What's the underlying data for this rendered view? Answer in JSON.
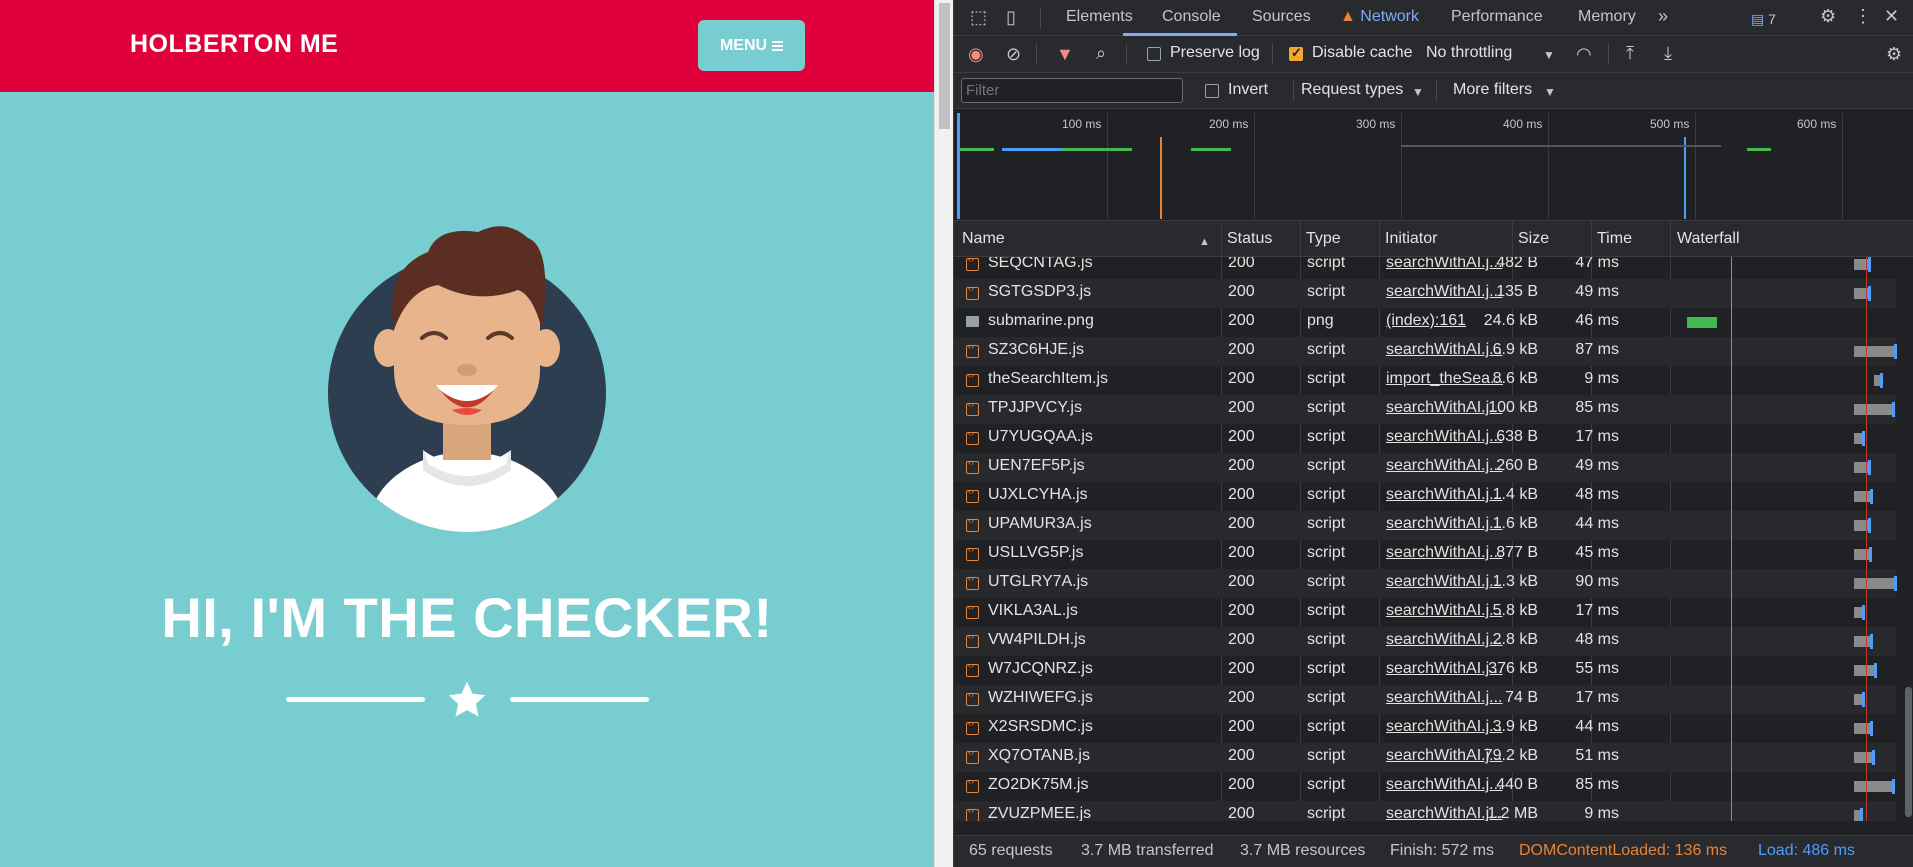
{
  "page": {
    "brand": "HOLBERTON ME",
    "menu_label": "MENU",
    "hero_title": "HI, I'M THE CHECKER!"
  },
  "devtools": {
    "tabs": [
      "Elements",
      "Console",
      "Sources",
      "Network",
      "Performance",
      "Memory"
    ],
    "active_tab": "Network",
    "issues_count": "7",
    "toolbar": {
      "preserve_log": "Preserve log",
      "disable_cache": "Disable cache",
      "throttling": "No throttling"
    },
    "filter": {
      "placeholder": "Filter",
      "invert": "Invert",
      "request_types": "Request types",
      "more_filters": "More filters"
    },
    "timeline_ticks": [
      "100 ms",
      "200 ms",
      "300 ms",
      "400 ms",
      "500 ms",
      "600 ms"
    ],
    "columns": [
      "Name",
      "Status",
      "Type",
      "Initiator",
      "Size",
      "Time",
      "Waterfall"
    ],
    "rows": [
      {
        "name": "SEQCNTAG.js",
        "status": "200",
        "type": "script",
        "initiator": "searchWithAI.j...",
        "size": "482 B",
        "time": "47 ms"
      },
      {
        "name": "SGTGSDP3.js",
        "status": "200",
        "type": "script",
        "initiator": "searchWithAI.j...",
        "size": "135 B",
        "time": "49 ms"
      },
      {
        "name": "submarine.png",
        "status": "200",
        "type": "png",
        "initiator": "(index):161",
        "size": "24.6 kB",
        "time": "46 ms"
      },
      {
        "name": "SZ3C6HJE.js",
        "status": "200",
        "type": "script",
        "initiator": "searchWithAI.j...",
        "size": "6.9 kB",
        "time": "87 ms"
      },
      {
        "name": "theSearchItem.js",
        "status": "200",
        "type": "script",
        "initiator": "import_theSea...",
        "size": "8.6 kB",
        "time": "9 ms"
      },
      {
        "name": "TPJJPVCY.js",
        "status": "200",
        "type": "script",
        "initiator": "searchWithAI.j...",
        "size": "100 kB",
        "time": "85 ms"
      },
      {
        "name": "U7YUGQAA.js",
        "status": "200",
        "type": "script",
        "initiator": "searchWithAI.j...",
        "size": "638 B",
        "time": "17 ms"
      },
      {
        "name": "UEN7EF5P.js",
        "status": "200",
        "type": "script",
        "initiator": "searchWithAI.j...",
        "size": "260 B",
        "time": "49 ms"
      },
      {
        "name": "UJXLCYHA.js",
        "status": "200",
        "type": "script",
        "initiator": "searchWithAI.j...",
        "size": "1.4 kB",
        "time": "48 ms"
      },
      {
        "name": "UPAMUR3A.js",
        "status": "200",
        "type": "script",
        "initiator": "searchWithAI.j...",
        "size": "1.6 kB",
        "time": "44 ms"
      },
      {
        "name": "USLLVG5P.js",
        "status": "200",
        "type": "script",
        "initiator": "searchWithAI.j...",
        "size": "877 B",
        "time": "45 ms"
      },
      {
        "name": "UTGLRY7A.js",
        "status": "200",
        "type": "script",
        "initiator": "searchWithAI.j...",
        "size": "1.3 kB",
        "time": "90 ms"
      },
      {
        "name": "VIKLA3AL.js",
        "status": "200",
        "type": "script",
        "initiator": "searchWithAI.j...",
        "size": "5.8 kB",
        "time": "17 ms"
      },
      {
        "name": "VW4PILDH.js",
        "status": "200",
        "type": "script",
        "initiator": "searchWithAI.j...",
        "size": "2.8 kB",
        "time": "48 ms"
      },
      {
        "name": "W7JCQNRZ.js",
        "status": "200",
        "type": "script",
        "initiator": "searchWithAI.j...",
        "size": "376 kB",
        "time": "55 ms"
      },
      {
        "name": "WZHIWEFG.js",
        "status": "200",
        "type": "script",
        "initiator": "searchWithAI.j...",
        "size": "74 B",
        "time": "17 ms"
      },
      {
        "name": "X2SRSDMC.js",
        "status": "200",
        "type": "script",
        "initiator": "searchWithAI.j...",
        "size": "3.9 kB",
        "time": "44 ms"
      },
      {
        "name": "XQ7OTANB.js",
        "status": "200",
        "type": "script",
        "initiator": "searchWithAI.j...",
        "size": "79.2 kB",
        "time": "51 ms"
      },
      {
        "name": "ZO2DK75M.js",
        "status": "200",
        "type": "script",
        "initiator": "searchWithAI.j...",
        "size": "440 B",
        "time": "85 ms"
      },
      {
        "name": "ZVUZPMEE.js",
        "status": "200",
        "type": "script",
        "initiator": "searchWithAI.j...",
        "size": "1.2 MB",
        "time": "9 ms"
      }
    ],
    "status_bar": {
      "requests": "65 requests",
      "transferred": "3.7 MB transferred",
      "resources": "3.7 MB resources",
      "finish": "Finish: 572 ms",
      "dom_content_loaded": "DOMContentLoaded: 136 ms",
      "load": "Load: 486 ms"
    }
  },
  "colors": {
    "header_red": "#E0003C",
    "page_teal": "#78CDD1",
    "devtools_bg": "#202124",
    "accent_blue": "#7CACF8",
    "dcl_orange": "#E8833A"
  }
}
